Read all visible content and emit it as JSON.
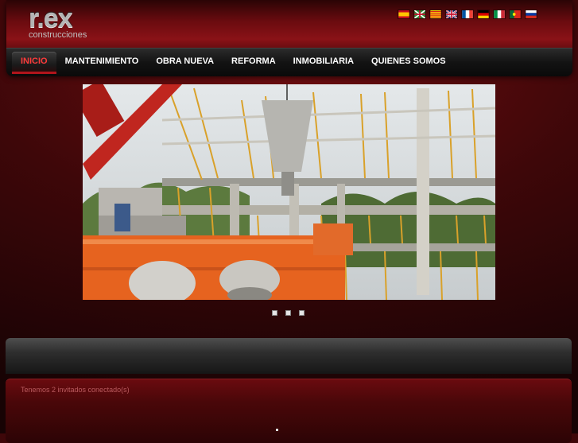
{
  "logo": {
    "mark": "r.ex",
    "subtitle": "construcciones"
  },
  "languages": [
    {
      "code": "es",
      "name": "Español"
    },
    {
      "code": "eu",
      "name": "Euskara"
    },
    {
      "code": "ca",
      "name": "Català"
    },
    {
      "code": "en",
      "name": "English"
    },
    {
      "code": "fr",
      "name": "Français"
    },
    {
      "code": "de",
      "name": "Deutsch"
    },
    {
      "code": "it",
      "name": "Italiano"
    },
    {
      "code": "pt",
      "name": "Português"
    },
    {
      "code": "ru",
      "name": "Русский"
    }
  ],
  "nav": {
    "items": [
      {
        "label": "INICIO",
        "active": true
      },
      {
        "label": "MANTENIMIENTO"
      },
      {
        "label": "OBRA NUEVA"
      },
      {
        "label": "REFORMA"
      },
      {
        "label": "INMOBILIARIA"
      },
      {
        "label": "QUIENES SOMOS"
      }
    ]
  },
  "slideshow": {
    "slides": 3,
    "active": 1,
    "image": "construction-site-photo"
  },
  "footer": {
    "visitors": "Tenemos 2 invitados conectado(s)"
  }
}
